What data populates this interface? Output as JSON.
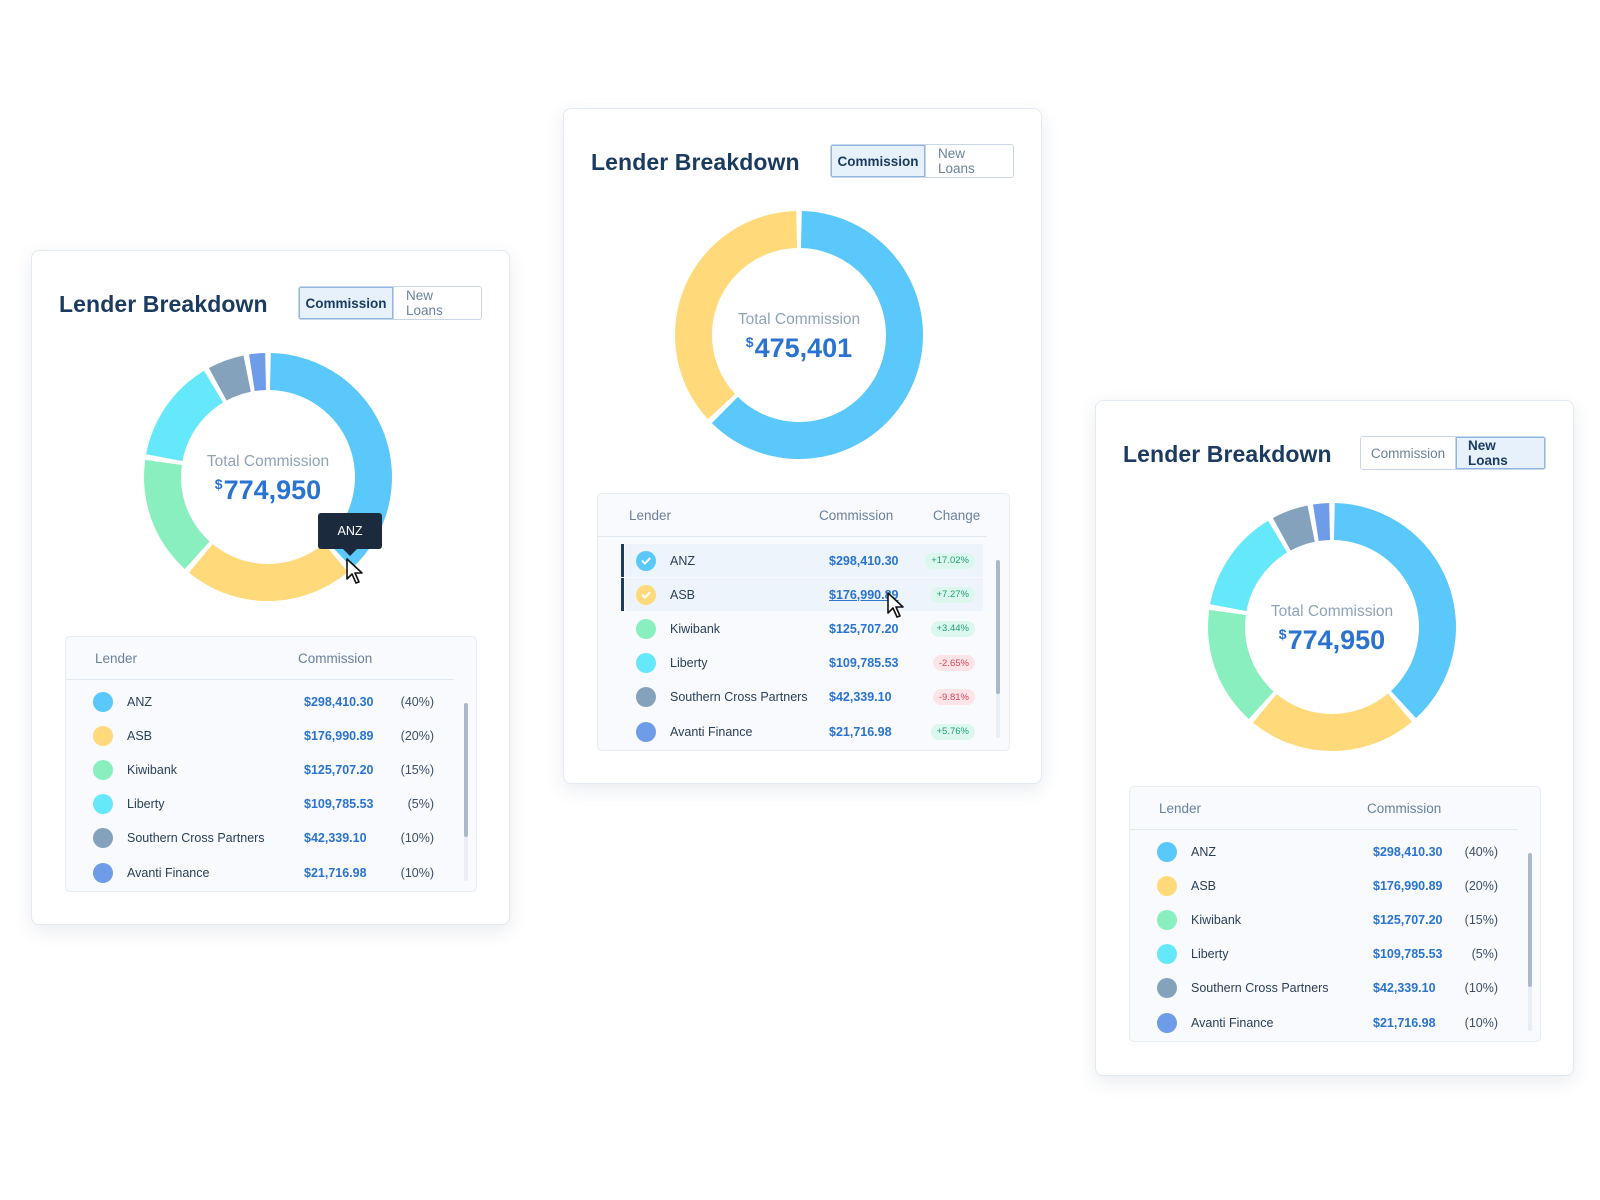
{
  "cards": {
    "left": {
      "title": "Lender Breakdown",
      "toggle": [
        "Commission",
        "New Loans"
      ],
      "selected": "Commission",
      "donut": {
        "label": "Total Commission",
        "currency": "$",
        "value": "774,950"
      },
      "tooltip": "ANZ",
      "table": {
        "headers": [
          "Lender",
          "Commission"
        ],
        "rows": [
          {
            "name": "ANZ",
            "commission": "$298,410.30",
            "pct": "(40%)",
            "color": "#5ac8fa"
          },
          {
            "name": "ASB",
            "commission": "$176,990.89",
            "pct": "(20%)",
            "color": "#ffd97a"
          },
          {
            "name": "Kiwibank",
            "commission": "$125,707.20",
            "pct": "(15%)",
            "color": "#8aefbf"
          },
          {
            "name": "Liberty",
            "commission": "$109,785.53",
            "pct": "(5%)",
            "color": "#66e8fb"
          },
          {
            "name": "Southern Cross Partners",
            "commission": "$42,339.10",
            "pct": "(10%)",
            "color": "#84a2bc"
          },
          {
            "name": "Avanti Finance",
            "commission": "$21,716.98",
            "pct": "(10%)",
            "color": "#6f9ce8"
          }
        ]
      }
    },
    "mid": {
      "title": "Lender Breakdown",
      "toggle": [
        "Commission",
        "New Loans"
      ],
      "selected": "Commission",
      "donut": {
        "label": "Total Commission",
        "currency": "$",
        "value": "475,401"
      },
      "table": {
        "headers": [
          "Lender",
          "Commission",
          "Change"
        ],
        "rows": [
          {
            "name": "ANZ",
            "commission": "$298,410.30",
            "change": "+17.02%",
            "dir": "pos",
            "color": "#5ac8fa",
            "checked": true
          },
          {
            "name": "ASB",
            "commission": "$176,990.89",
            "change": "+7.27%",
            "dir": "pos",
            "color": "#ffd97a",
            "checked": true
          },
          {
            "name": "Kiwibank",
            "commission": "$125,707.20",
            "change": "+3.44%",
            "dir": "pos",
            "color": "#8aefbf",
            "checked": false
          },
          {
            "name": "Liberty",
            "commission": "$109,785.53",
            "change": "-2.65%",
            "dir": "neg",
            "color": "#66e8fb",
            "checked": false
          },
          {
            "name": "Southern Cross Partners",
            "commission": "$42,339.10",
            "change": "-9.81%",
            "dir": "neg",
            "color": "#84a2bc",
            "checked": false
          },
          {
            "name": "Avanti Finance",
            "commission": "$21,716.98",
            "change": "+5.76%",
            "dir": "pos",
            "color": "#6f9ce8",
            "checked": false
          }
        ]
      }
    },
    "right": {
      "title": "Lender Breakdown",
      "toggle": [
        "Commission",
        "New Loans"
      ],
      "selected": "New Loans",
      "donut": {
        "label": "Total Commission",
        "currency": "$",
        "value": "774,950"
      },
      "table": {
        "headers": [
          "Lender",
          "Commission"
        ],
        "rows": [
          {
            "name": "ANZ",
            "commission": "$298,410.30",
            "pct": "(40%)",
            "color": "#5ac8fa"
          },
          {
            "name": "ASB",
            "commission": "$176,990.89",
            "pct": "(20%)",
            "color": "#ffd97a"
          },
          {
            "name": "Kiwibank",
            "commission": "$125,707.20",
            "pct": "(15%)",
            "color": "#8aefbf"
          },
          {
            "name": "Liberty",
            "commission": "$109,785.53",
            "pct": "(5%)",
            "color": "#66e8fb"
          },
          {
            "name": "Southern Cross Partners",
            "commission": "$42,339.10",
            "pct": "(10%)",
            "color": "#84a2bc"
          },
          {
            "name": "Avanti Finance",
            "commission": "$21,716.98",
            "pct": "(10%)",
            "color": "#6f9ce8"
          }
        ]
      }
    }
  },
  "chart_data": [
    {
      "type": "pie",
      "categories": [
        "ANZ",
        "ASB",
        "Kiwibank",
        "Liberty",
        "Southern Cross Partners",
        "Avanti Finance"
      ],
      "values": [
        298410.3,
        176990.89,
        125707.2,
        109785.53,
        42339.1,
        21716.98
      ]
    },
    {
      "type": "pie",
      "categories": [
        "ANZ",
        "ASB"
      ],
      "values": [
        298410.3,
        176990.89
      ]
    },
    {
      "type": "pie",
      "categories": [
        "ANZ",
        "ASB",
        "Kiwibank",
        "Liberty",
        "Southern Cross Partners",
        "Avanti Finance"
      ],
      "values": [
        298410.3,
        176990.89,
        125707.2,
        109785.53,
        42339.1,
        21716.98
      ]
    }
  ]
}
